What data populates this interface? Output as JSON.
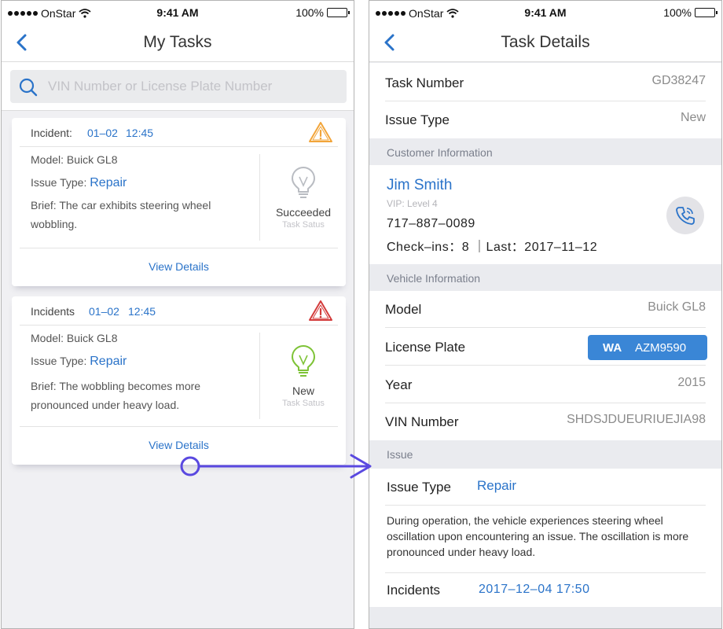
{
  "status_bar": {
    "carrier": "OnStar",
    "time": "9:41 AM",
    "battery": "100%"
  },
  "colors": {
    "accent": "#2a73c9",
    "warning_orange": "#f2a53a",
    "warning_red": "#d33b3b",
    "success_green": "#7ec337",
    "plate_bg": "#3a86d6"
  },
  "left": {
    "title": "My Tasks",
    "search": {
      "placeholder": "VIN Number or License Plate Number",
      "icon": "search-icon"
    },
    "tasks": [
      {
        "incident_label": "Incident:",
        "date": "01–02",
        "time": "12:45",
        "warning_icon": "warning-triangle-orange",
        "model": "Model: Buick GL8",
        "issue_label": "Issue Type:",
        "issue_value": "Repair",
        "brief": "Brief: The car exhibits steering wheel wobbling.",
        "status": "Succeeded",
        "status_label": "Task Satus",
        "status_icon": "lightbulb-gray",
        "view_details": "View Details"
      },
      {
        "incident_label": "Incidents",
        "date": "01–02",
        "time": "12:45",
        "warning_icon": "warning-triangle-red",
        "model": "Model: Buick GL8",
        "issue_label": "Issue Type:",
        "issue_value": "Repair",
        "brief": "Brief: The wobbling becomes more pronounced under heavy load.",
        "status": "New",
        "status_label": "Task Satus",
        "status_icon": "lightbulb-green",
        "view_details": "View Details"
      }
    ]
  },
  "right": {
    "title": "Task Details",
    "task_number_label": "Task Number",
    "task_number": "GD38247",
    "issue_type_label": "Issue Type",
    "issue_type": "New",
    "customer_header": "Customer Information",
    "customer": {
      "name": "Jim Smith",
      "vip": "VIP:  Level 4",
      "phone": "717–887–0089",
      "checkins": "Check–ins：8 ｜Last：2017–11–12",
      "call_icon": "phone-icon"
    },
    "vehicle_header": "Vehicle Information",
    "vehicle": {
      "model_label": "Model",
      "model": "Buick GL8",
      "plate_label": "License Plate",
      "plate_prefix": "WA",
      "plate_number": "AZM9590",
      "year_label": "Year",
      "year": "2015",
      "vin_label": "VIN Number",
      "vin": "SHDSJDUEURIUEJIA98"
    },
    "issue_header": "Issue",
    "issue": {
      "type_label": "Issue Type",
      "type": "Repair",
      "description": "During operation, the vehicle experiences steering wheel oscillation upon encountering an issue. The oscillation is more pronounced under heavy load.",
      "incidents_label": "Incidents",
      "incidents": "2017–12–04 17:50"
    }
  }
}
